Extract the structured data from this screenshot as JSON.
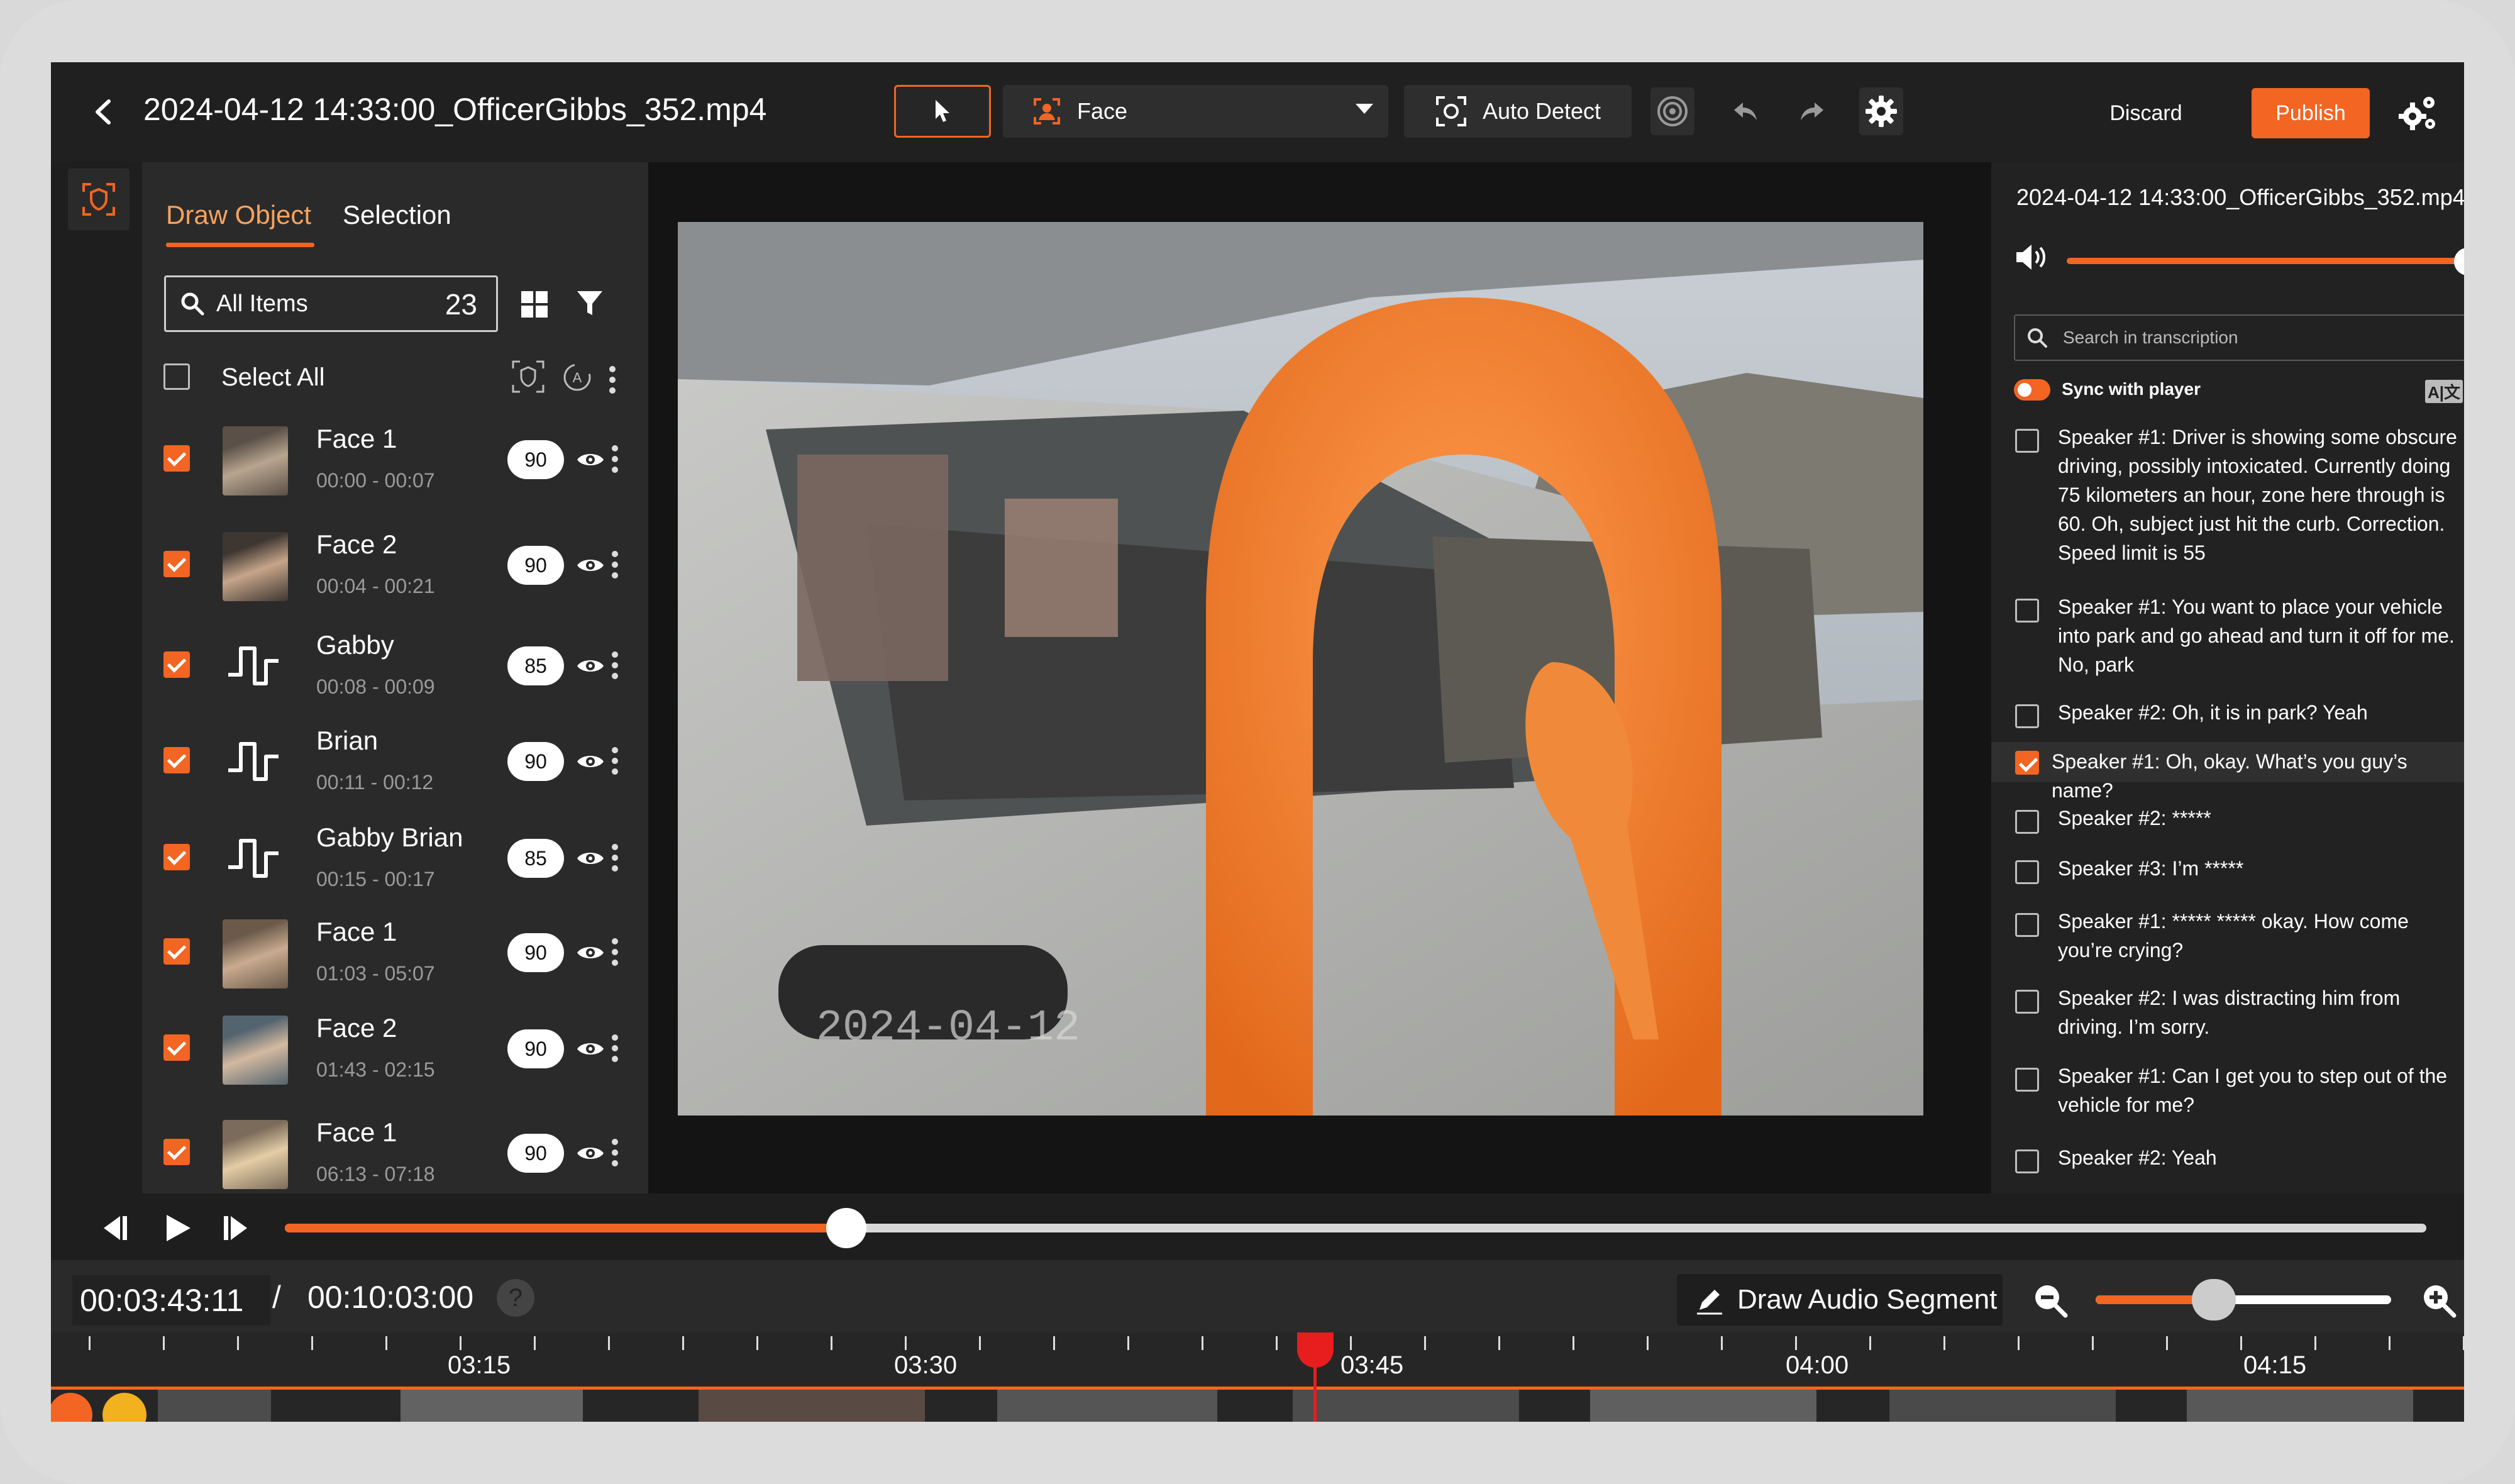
{
  "header": {
    "title": "2024-04-12 14:33:00_OfficerGibbs_352.mp4",
    "face_select": "Face",
    "auto_detect": "Auto Detect",
    "discard": "Discard",
    "publish": "Publish"
  },
  "left_panel": {
    "tabs": [
      "Draw Object",
      "Selection"
    ],
    "active_tab": "Draw Object",
    "filter_label": "All Items",
    "filter_count": "23",
    "select_all": "Select All",
    "items": [
      {
        "name": "Face 1",
        "time": "00:00 - 00:07",
        "score": "90",
        "kind": "face"
      },
      {
        "name": "Face 2",
        "time": "00:04 - 00:21",
        "score": "90",
        "kind": "face"
      },
      {
        "name": "Gabby",
        "time": "00:08 - 00:09",
        "score": "85",
        "kind": "audio"
      },
      {
        "name": "Brian",
        "time": "00:11 - 00:12",
        "score": "90",
        "kind": "audio"
      },
      {
        "name": "Gabby Brian",
        "time": "00:15 - 00:17",
        "score": "85",
        "kind": "audio"
      },
      {
        "name": "Face 1",
        "time": "01:03 - 05:07",
        "score": "90",
        "kind": "face"
      },
      {
        "name": "Face 2",
        "time": "01:43 - 02:15",
        "score": "90",
        "kind": "face"
      },
      {
        "name": "Face 1",
        "time": "06:13 - 07:18",
        "score": "90",
        "kind": "face"
      }
    ]
  },
  "video": {
    "overlay_date": "2024-04-12"
  },
  "transcript": {
    "file_title": "2024-04-12 14:33:00_OfficerGibbs_352.mp4",
    "volume": 1.0,
    "search_placeholder": "Search in transcription",
    "sync_label": "Sync with player",
    "sync_on": true,
    "lines": [
      {
        "text": "Speaker #1: Driver is showing some obscure driving, possibly intoxicated. Currently doing 75 kilometers an hour, zone here through is 60. Oh, subject just hit the curb. Correction. Speed limit is 55",
        "checked": false
      },
      {
        "text": "Speaker #1: You want to place your vehicle into park and go ahead and turn it off for me. No, park",
        "checked": false
      },
      {
        "text": "Speaker #2: Oh, it is in park? Yeah",
        "checked": false
      },
      {
        "text": "Speaker #1: Oh, okay. What’s you guy’s name?",
        "checked": true
      },
      {
        "text": "Speaker #2: *****",
        "checked": false
      },
      {
        "text": "Speaker #3: I’m *****",
        "checked": false
      },
      {
        "text": "Speaker #1: ***** ***** okay. How come you’re crying?",
        "checked": false
      },
      {
        "text": "Speaker #2: I was distracting him from driving. I’m sorry.",
        "checked": false
      },
      {
        "text": "Speaker #1: Can I get you to step out of the vehicle for me?",
        "checked": false
      },
      {
        "text": "Speaker #2: Yeah",
        "checked": false
      }
    ]
  },
  "player": {
    "progress": 0.2622,
    "current_time": "00:03:43:11",
    "separator": "/",
    "total_time": "00:10:03:00",
    "help": "?",
    "draw_audio_segment": "Draw Audio Segment",
    "zoom_level": 0.4
  },
  "timeline": {
    "labels": [
      "03:15",
      "03:30",
      "03:45",
      "04:00",
      "04:15"
    ]
  },
  "colors": {
    "accent": "#f26522",
    "playhead": "#e81d1d",
    "background": "#252525"
  }
}
